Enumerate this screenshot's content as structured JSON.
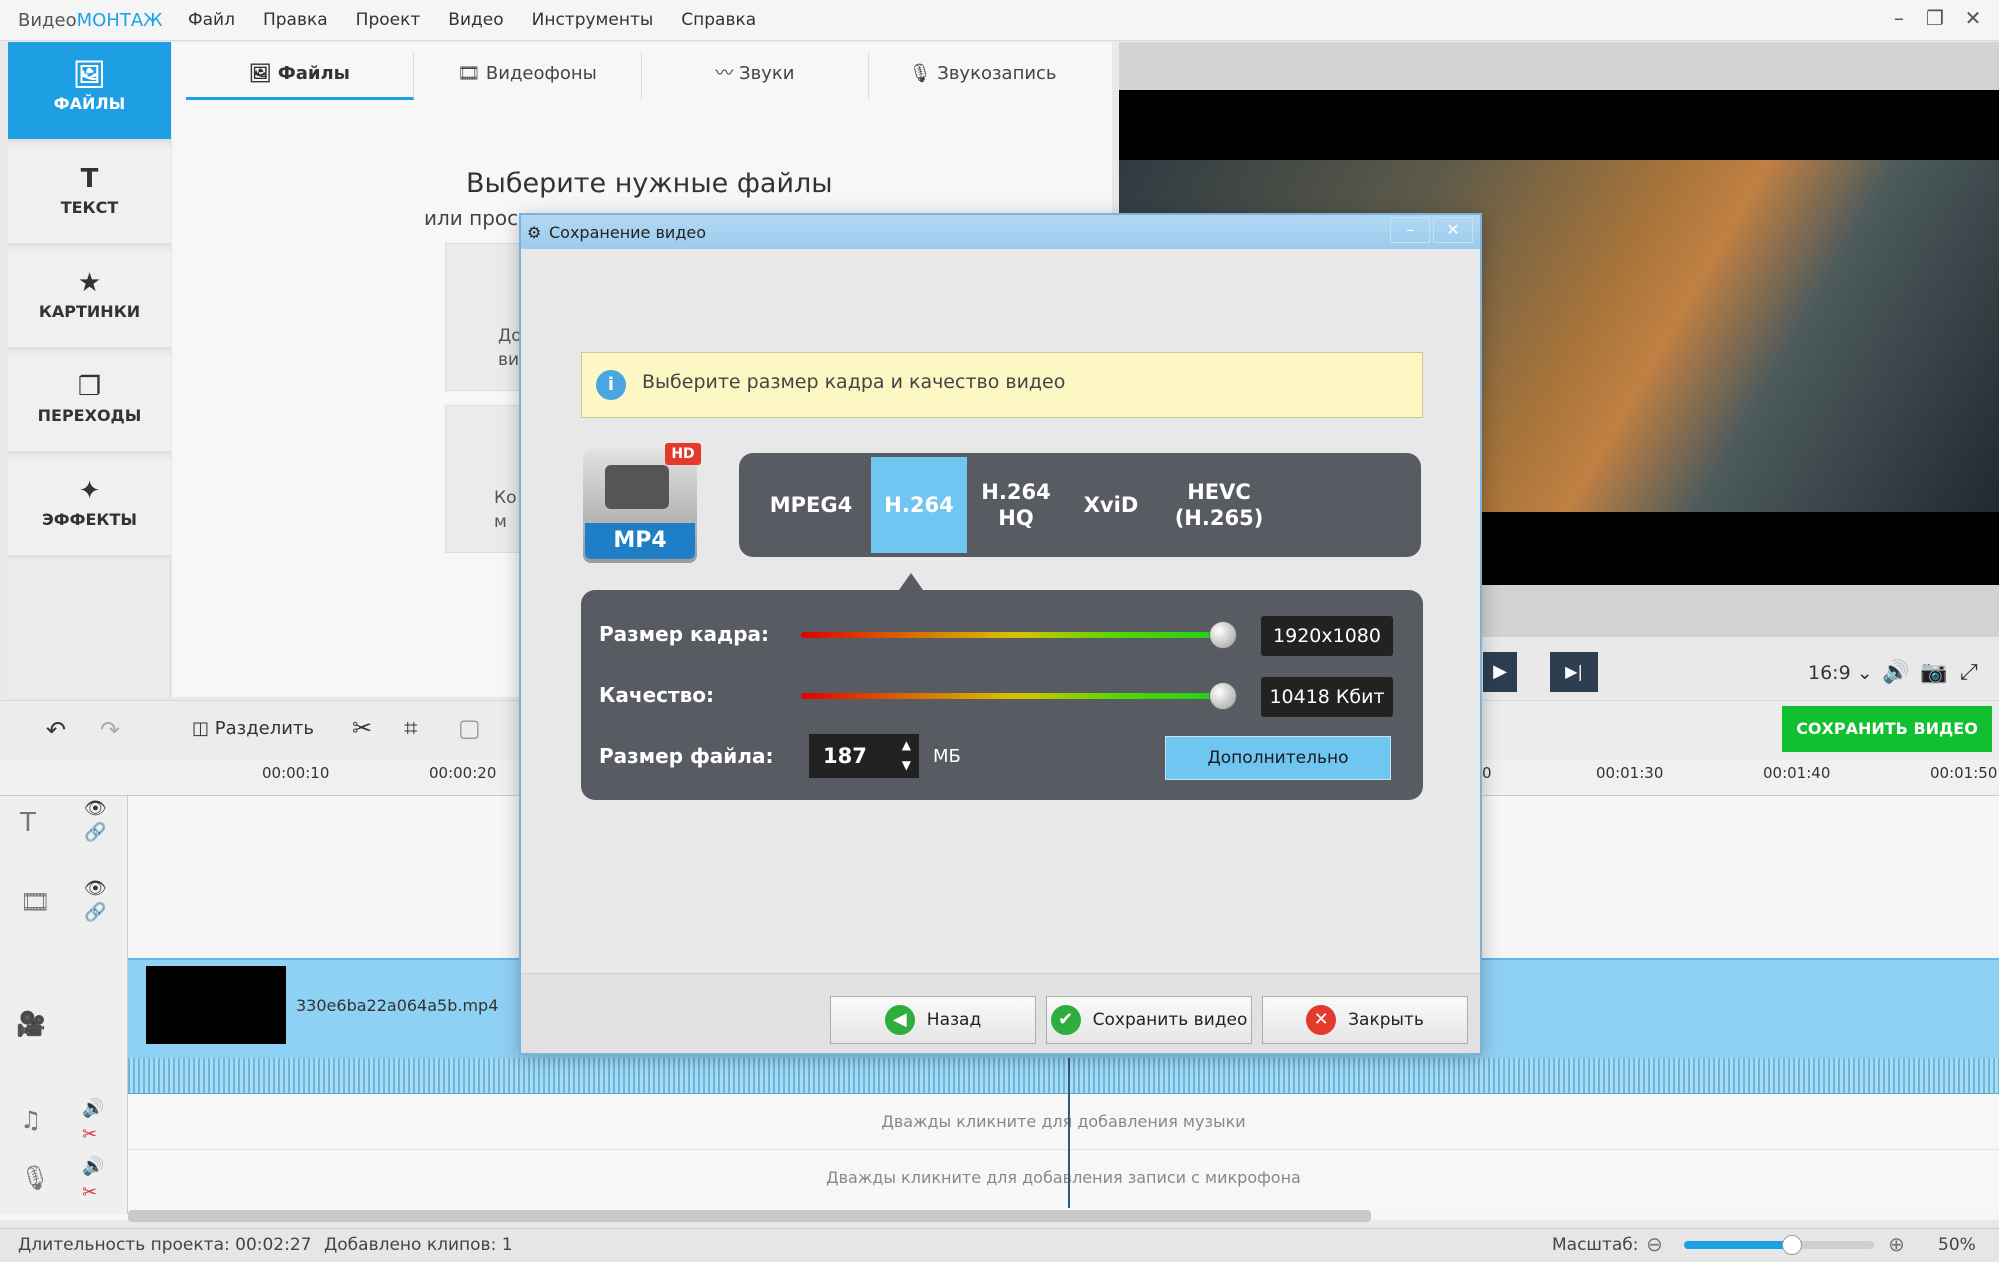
{
  "app": {
    "logo_part1": "Видео",
    "logo_part2": "МОНТАЖ",
    "menu": [
      "Файл",
      "Правка",
      "Проект",
      "Видео",
      "Инструменты",
      "Справка"
    ]
  },
  "sidebar": {
    "items": [
      {
        "label": "ФАЙЛЫ",
        "icon": "image-icon"
      },
      {
        "label": "ТЕКСТ",
        "icon": "text-icon"
      },
      {
        "label": "КАРТИНКИ",
        "icon": "star-icon"
      },
      {
        "label": "ПЕРЕХОДЫ",
        "icon": "transitions-icon"
      },
      {
        "label": "ЭФФЕКТЫ",
        "icon": "magic-wand-icon"
      }
    ]
  },
  "tabs": [
    {
      "label": "Файлы"
    },
    {
      "label": "Видеофоны"
    },
    {
      "label": "Звуки"
    },
    {
      "label": "Звукозапись"
    }
  ],
  "panel": {
    "heading": "Выберите нужные файлы",
    "subheading": "или прос",
    "card1": "До",
    "card1b": "виде",
    "card2": "Ко",
    "card2b": "м"
  },
  "preview": {
    "aspect": "16:9"
  },
  "toolbar": {
    "split_label": "Разделить",
    "save_video": "СОХРАНИТЬ ВИДЕО"
  },
  "ruler": {
    "ticks_left": [
      "00:00:10",
      "00:00:20"
    ],
    "ticks_right": [
      "0",
      "00:01:30",
      "00:01:40",
      "00:01:50"
    ]
  },
  "timeline": {
    "clip_name": "330e6ba22a064a5b.mp4",
    "music_hint": "Дважды кликните для добавления музыки",
    "mic_hint": "Дважды кликните для добавления записи с микрофона"
  },
  "status": {
    "duration_label": "Длительность проекта:",
    "duration_value": "00:02:27",
    "clips_label": "Добавлено клипов:",
    "clips_value": "1",
    "zoom_label": "Масштаб:",
    "zoom_value": "50%",
    "zoom_level": 0.57
  },
  "dialog": {
    "title": "Сохранение видео",
    "info": "Выберите размер кадра и качество видео",
    "format_badge": "HD",
    "format_label": "MP4",
    "codecs": [
      {
        "label": "MPEG4"
      },
      {
        "label": "H.264",
        "selected": true
      },
      {
        "label": "H.264 HQ"
      },
      {
        "label": "XviD"
      },
      {
        "label": "HEVC (H.265)"
      }
    ],
    "frame_size_label": "Размер кадра:",
    "frame_size_value": "1920x1080",
    "frame_size_level": 1.0,
    "quality_label": "Качество:",
    "quality_value": "10418 Кбит",
    "quality_level": 1.0,
    "file_size_label": "Размер файла:",
    "file_size_value": "187",
    "file_size_unit": "МБ",
    "advanced": "Дополнительно",
    "buttons": {
      "back": "Назад",
      "save": "Сохранить видео",
      "close": "Закрыть"
    }
  }
}
